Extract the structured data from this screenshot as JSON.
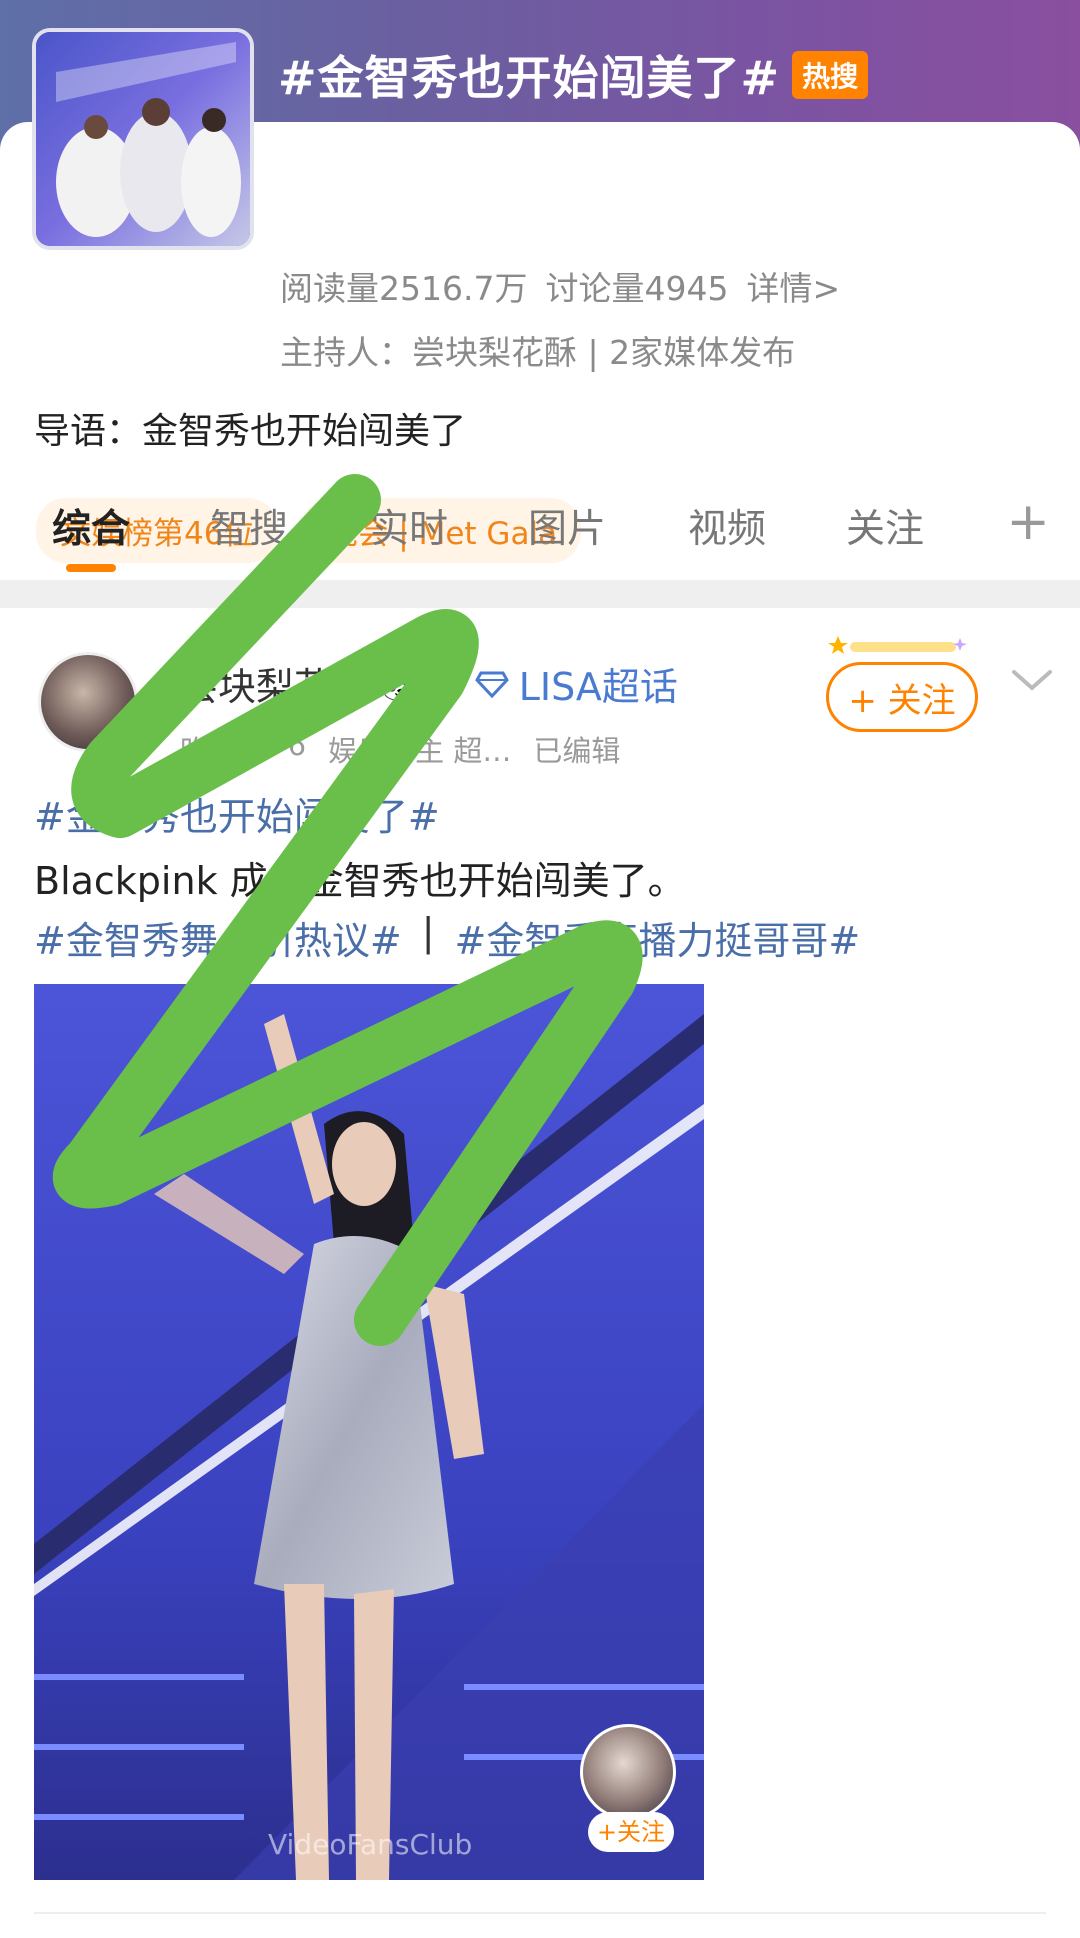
{
  "topic": {
    "title": "#金智秀也开始闯美了#",
    "hot_badge": "热搜",
    "read_count": "阅读量2516.7万",
    "discussion_count": "讨论量4945",
    "details_link": "详情>",
    "host": "主持人：尝块梨花酥 | 2家媒体发布",
    "intro": "导语：金智秀也开始闯美了",
    "chips": [
      "文娱榜第46位",
      "晚会 | Met Gala"
    ]
  },
  "tabs": {
    "items": [
      "综合",
      "智搜",
      "实时",
      "图片",
      "视频",
      "关注"
    ],
    "active": "综合",
    "plus": "+"
  },
  "post": {
    "author_name": "尝块梨花酥",
    "super_topic": "LISA超话",
    "emojis": "🐼🦈",
    "time": "昨天 2",
    "source": "6",
    "role": "娱乐博主 超…",
    "edited": "已编辑",
    "follow_label": "+ 关注",
    "hashtag_1": "#金智秀也开始闯美了#",
    "body_text": "Blackpink 成员金智秀也开始闯美了。",
    "hashtag_2": "#金智秀舞台引热议#",
    "separator": "|",
    "hashtag_3": "#金智秀直播力挺哥哥#",
    "video_watermark": "VideoFansClub",
    "video_follow_label": "+关注"
  },
  "colors": {
    "accent": "#ff8200",
    "link": "#4a6ea8",
    "scribble": "#6abf4b"
  }
}
